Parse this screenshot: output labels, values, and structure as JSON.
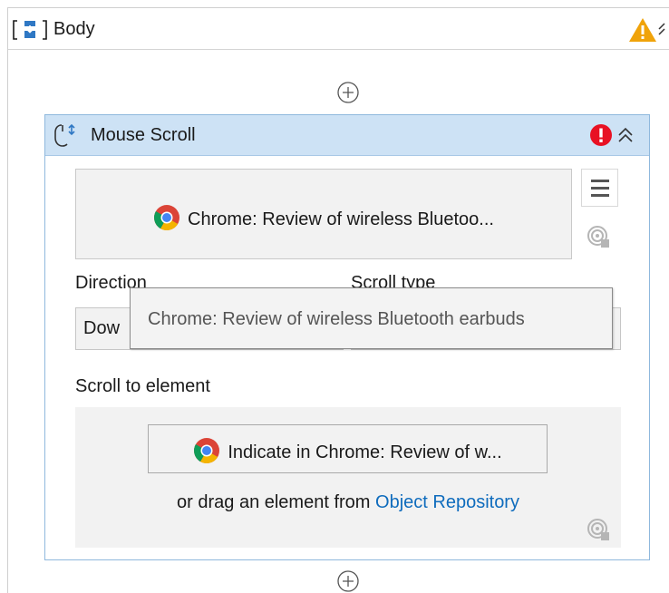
{
  "body": {
    "title": "Body",
    "icon": "sequence-icon",
    "warning_icon": "warning-icon",
    "collapse_icon": "collapse-icon"
  },
  "mouse_scroll": {
    "title": "Mouse Scroll",
    "icon": "mouse-scroll-icon",
    "error_icon": "error-icon",
    "collapse_icon": "collapse-icon",
    "target_label": "Chrome: Review of wireless Bluetoo...",
    "target_icon": "chrome-icon",
    "menu_icon": "hamburger-menu-icon",
    "target_mini_icon": "target-icon",
    "direction": {
      "label": "Direction",
      "value": "Dow"
    },
    "scroll_type": {
      "label": "Scroll type",
      "value": ""
    },
    "tooltip": "Chrome: Review of wireless Bluetooth earbuds",
    "scroll_to_element": {
      "label": "Scroll to element",
      "indicate_label": "Indicate in Chrome: Review of w...",
      "drag_prefix": "or drag an element from",
      "drag_link": "Object Repository"
    }
  },
  "add_activity_icon": "plus-circle-icon",
  "colors": {
    "card_header": "#cde2f5",
    "card_border": "#8fb8dd",
    "error_red": "#e81123",
    "warning_orange": "#f0a30a",
    "link_blue": "#0f6cbd"
  }
}
